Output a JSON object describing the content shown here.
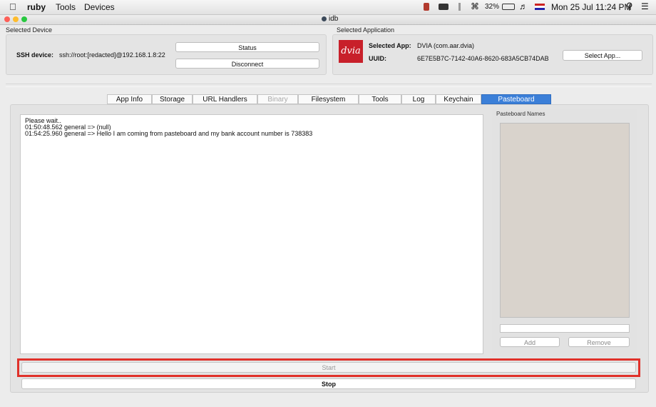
{
  "menubar": {
    "apple": "",
    "app_name": "ruby",
    "items": [
      "Tools",
      "Devices"
    ],
    "battery": "32%",
    "datetime": "Mon 25 Jul 11:24 PM"
  },
  "window": {
    "title": "idb"
  },
  "device": {
    "group_title": "Selected Device",
    "ssh_label": "SSH device:",
    "ssh_value": "ssh://root:[redacted]@192.168.1.8:22",
    "status_label": "Status",
    "disconnect_label": "Disconnect"
  },
  "application": {
    "group_title": "Selected Application",
    "logo_text": "dvia",
    "selected_label": "Selected App:",
    "selected_value": "DVIA (com.aar.dvia)",
    "uuid_label": "UUID:",
    "uuid_value": "6E7E5B7C-7142-40A6-8620-683A5CB74DAB",
    "select_button": "Select App..."
  },
  "tabs": [
    {
      "label": "App Info",
      "state": "normal"
    },
    {
      "label": "Storage",
      "state": "normal"
    },
    {
      "label": "URL Handlers",
      "state": "normal"
    },
    {
      "label": "Binary",
      "state": "disabled"
    },
    {
      "label": "Filesystem",
      "state": "normal"
    },
    {
      "label": "Tools",
      "state": "normal"
    },
    {
      "label": "Log",
      "state": "normal"
    },
    {
      "label": "Keychain",
      "state": "normal"
    },
    {
      "label": "Pasteboard",
      "state": "active"
    }
  ],
  "log": {
    "lines": [
      "Please wait..",
      "01:50:48.562 general => (null)",
      "01:54:25.960 general => Hello I am coming from pasteboard and my bank account number is 738383"
    ]
  },
  "pasteboard": {
    "title": "Pasteboard Names",
    "input_value": "",
    "add_button": "Add",
    "remove_button": "Remove"
  },
  "actions": {
    "start_label": "Start",
    "stop_label": "Stop"
  },
  "colors": {
    "active_tab": "#3b7fd8",
    "highlight": "#e0312a",
    "logo_bg": "#c8202a"
  }
}
